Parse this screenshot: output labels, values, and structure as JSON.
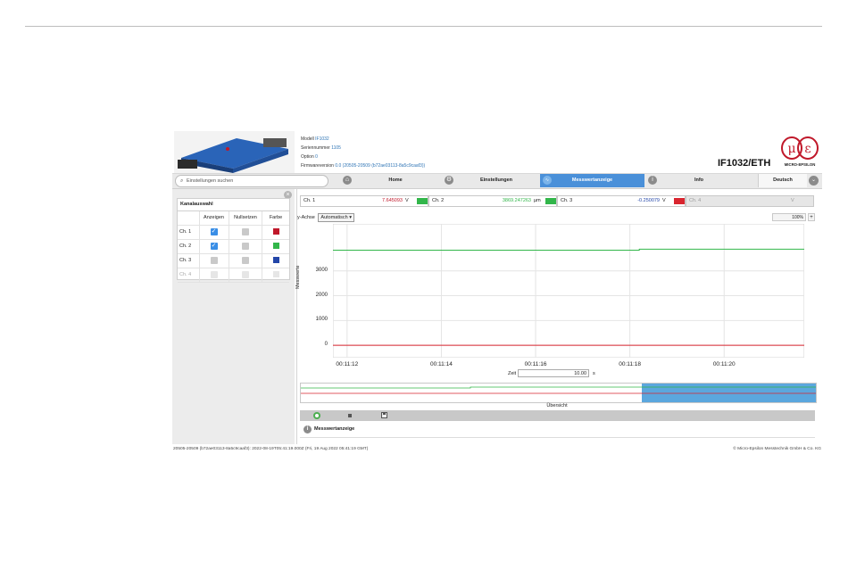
{
  "device": {
    "model_label": "Modell",
    "model_value": "IF1032",
    "serial_label": "Seriennummer",
    "serial_value": "1105",
    "option_label": "Option",
    "option_value": "0",
    "firmware_label": "Firmwareversion",
    "firmware_value": "0.0 (20505-20509 (b72ae03113-8a5c9caaf3))",
    "product_name": "IF1032/ETH",
    "logo_text": "MICRO-EPSILON"
  },
  "nav": {
    "search_placeholder": "Einstellungen suchen",
    "home": "Home",
    "settings": "Einstellungen",
    "measure": "Messwertanzeige",
    "info": "Info",
    "language": "Deutsch"
  },
  "kanal": {
    "title": "Kanalauswahl",
    "headers": [
      "Anzeigen",
      "Nullsetzen",
      "Farbe"
    ],
    "rows": [
      {
        "name": "Ch. 1",
        "show": "on",
        "color": "#c0182a"
      },
      {
        "name": "Ch. 2",
        "show": "on",
        "color": "#32b64a"
      },
      {
        "name": "Ch. 3",
        "show": "off",
        "color": "#2346a8"
      },
      {
        "name": "Ch. 4",
        "show": "dis",
        "color": "#e6e6e6"
      }
    ]
  },
  "channels": [
    {
      "name": "Ch. 1",
      "value": "7.645093",
      "unit": "V",
      "color": "#c0182a",
      "swatch": "#32b64a"
    },
    {
      "name": "Ch. 2",
      "value": "3869.247263",
      "unit": "µm",
      "color": "#32b64a",
      "swatch": "#32b64a"
    },
    {
      "name": "Ch. 3",
      "value": "-0.250079",
      "unit": "V",
      "color": "#2346a8",
      "swatch": "#d9252f"
    },
    {
      "name": "Ch. 4",
      "value": "",
      "unit": "V",
      "color": "#999999",
      "swatch": ""
    }
  ],
  "toolbar": {
    "yaxis_label": "y-Achse",
    "yaxis_mode": "Automatisch ▾",
    "zoom": "100%",
    "zoom_plus": "+"
  },
  "chart_data": {
    "type": "line",
    "ylabel": "Messwerte",
    "xlabel": "",
    "y_ticks": [
      "3000",
      "2000",
      "1000",
      "0"
    ],
    "y_tick_values": [
      3000,
      2000,
      1000,
      0
    ],
    "x_ticks": [
      "00:11:12",
      "00:11:14",
      "00:11:16",
      "00:11:18",
      "00:11:20"
    ],
    "ylim": [
      -500,
      4900
    ],
    "xlim": [
      0,
      10
    ],
    "grid": true,
    "series": [
      {
        "color": "#32b64a",
        "x": [
          0,
          6.5,
          6.5,
          10
        ],
        "y": [
          3840,
          3840,
          3880,
          3880
        ]
      },
      {
        "color": "#d9252f",
        "x": [
          0,
          10
        ],
        "y": [
          0,
          0
        ]
      }
    ]
  },
  "zeit": {
    "label": "Zeit",
    "value": "10.00",
    "unit": "s"
  },
  "overview": {
    "label": "Übersicht"
  },
  "panel": {
    "title": "Messwertanzeige"
  },
  "status": {
    "left": "20505-20509 (b72ae03113-8a5c9caaf3): 2022-08-19T05:41:19.000Z (Fri, 19 Aug 2022 05:41:19 GMT)",
    "right": "© Micro-Epsilon Messtechnik GmbH & Co. KG"
  }
}
